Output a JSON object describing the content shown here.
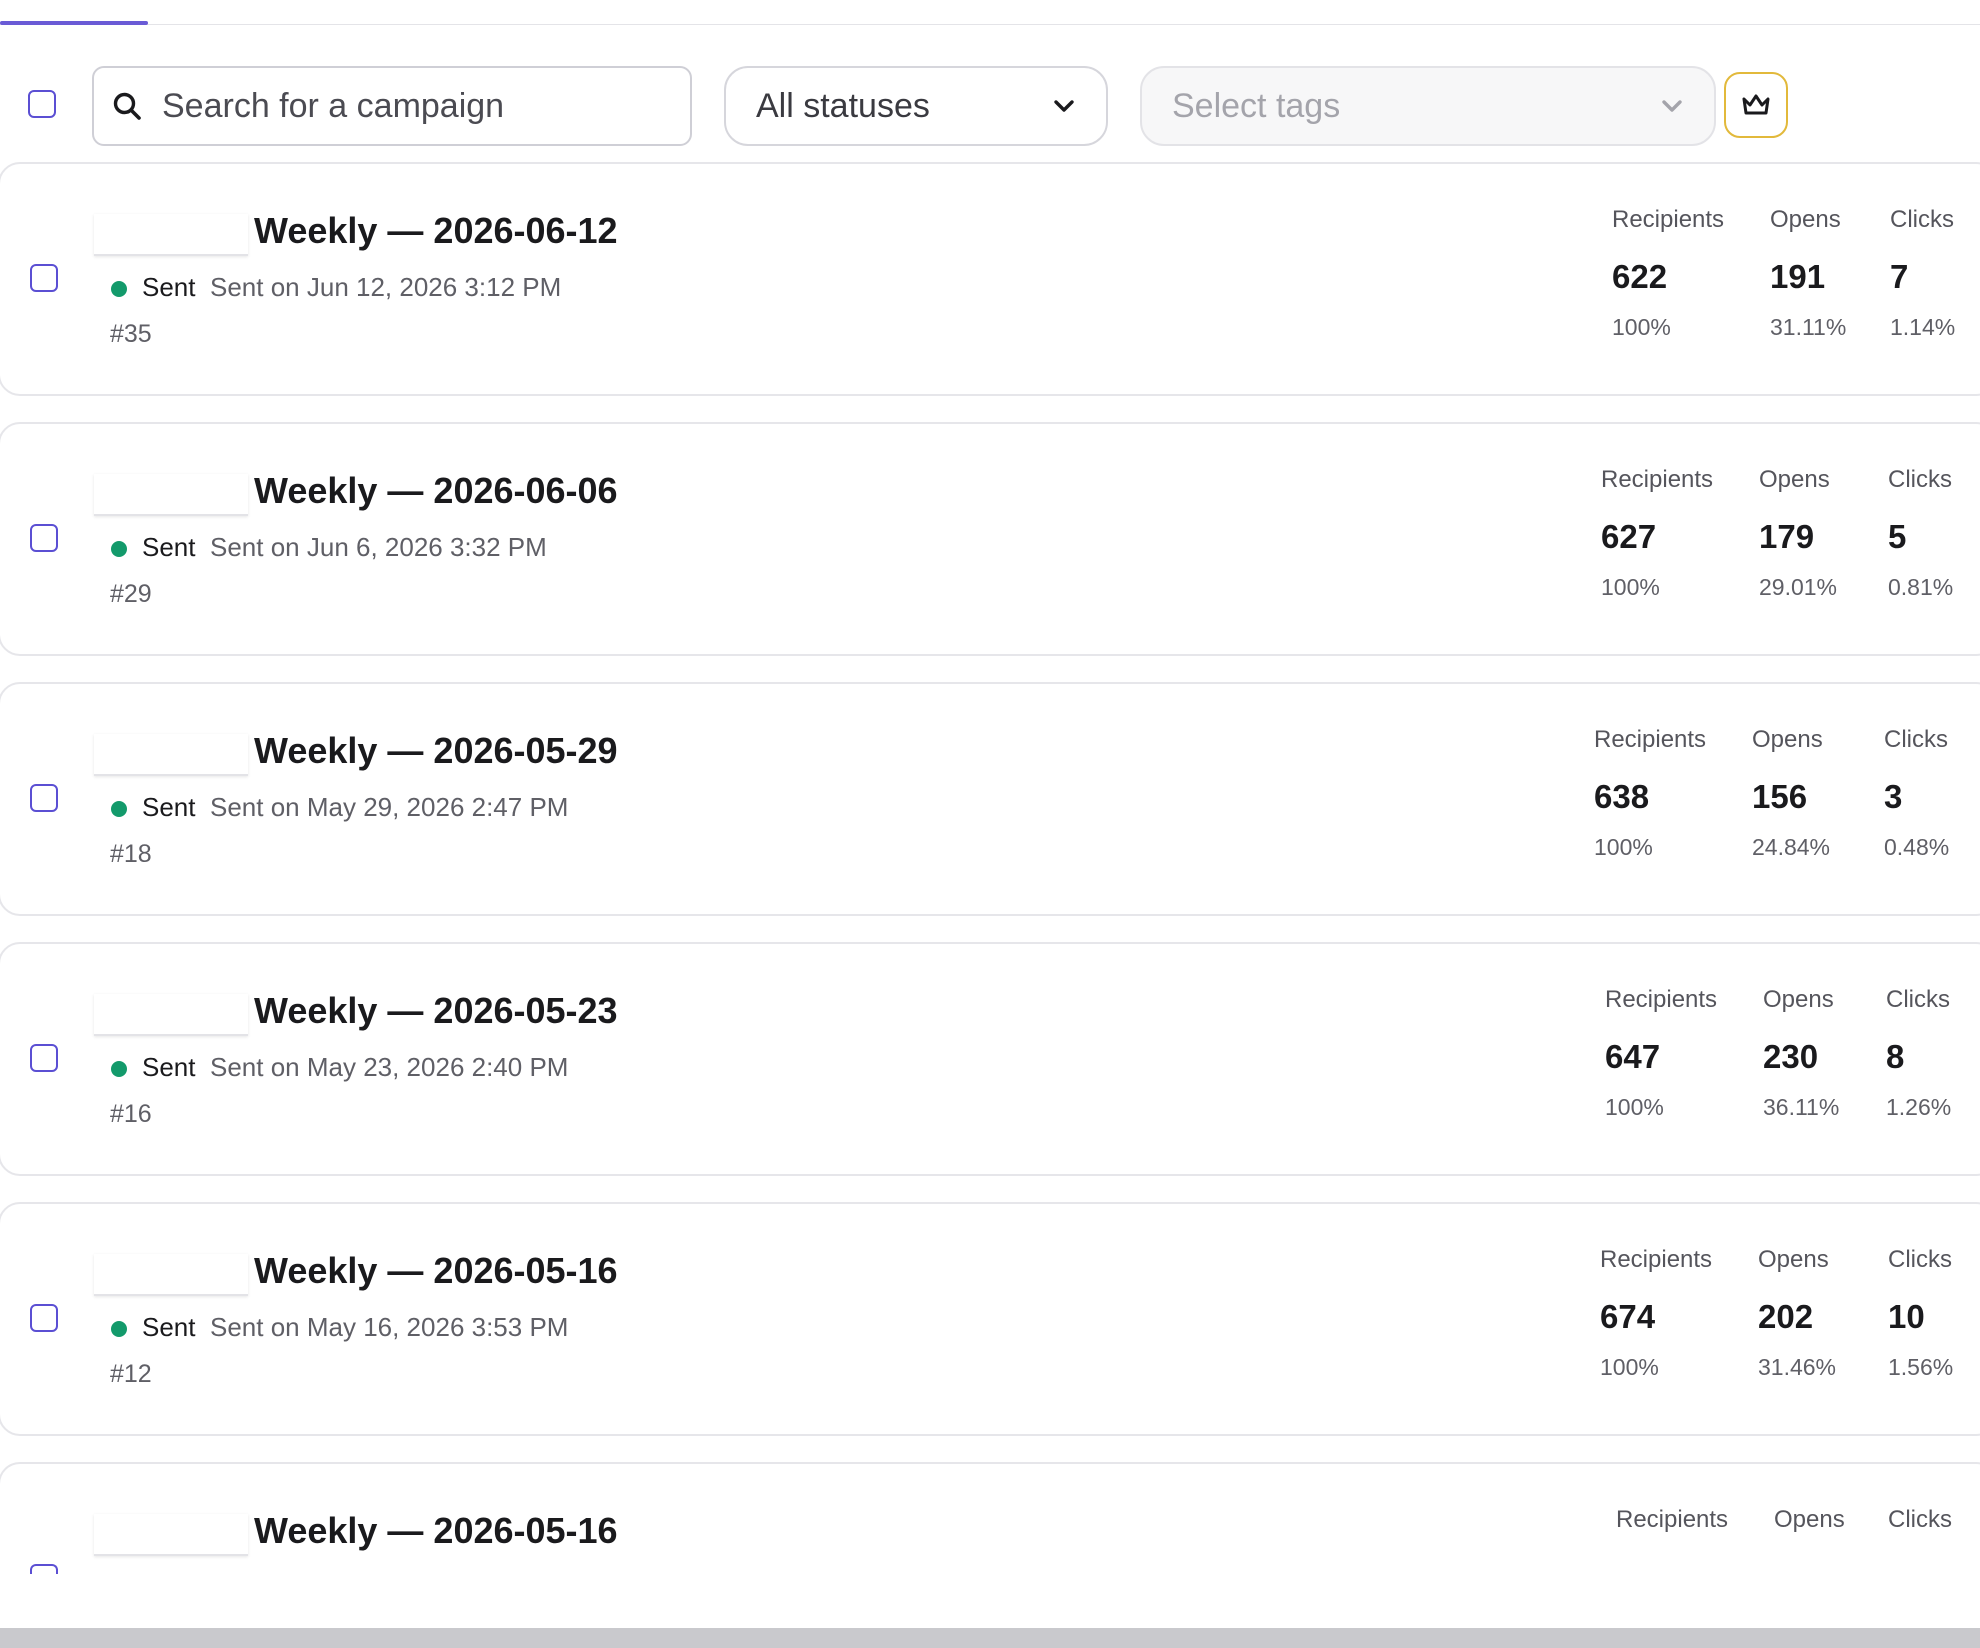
{
  "toolbar": {
    "search_placeholder": "Search for a campaign",
    "status_filter": "All statuses",
    "tags_placeholder": "Select tags"
  },
  "stat_labels": {
    "recipients": "Recipients",
    "opens": "Opens",
    "clicks": "Clicks"
  },
  "campaigns": [
    {
      "title": "Weekly — 2026-06-12",
      "status": "Sent",
      "sent_on": "Sent on Jun 12, 2026 3:12 PM",
      "id": "#35",
      "recipients": "622",
      "recipients_pct": "100%",
      "opens": "191",
      "opens_pct": "31.11%",
      "clicks": "7",
      "clicks_pct": "1.14%"
    },
    {
      "title": "Weekly — 2026-06-06",
      "status": "Sent",
      "sent_on": "Sent on Jun 6, 2026 3:32 PM",
      "id": "#29",
      "recipients": "627",
      "recipients_pct": "100%",
      "opens": "179",
      "opens_pct": "29.01%",
      "clicks": "5",
      "clicks_pct": "0.81%"
    },
    {
      "title": "Weekly — 2026-05-29",
      "status": "Sent",
      "sent_on": "Sent on May 29, 2026 2:47 PM",
      "id": "#18",
      "recipients": "638",
      "recipients_pct": "100%",
      "opens": "156",
      "opens_pct": "24.84%",
      "clicks": "3",
      "clicks_pct": "0.48%"
    },
    {
      "title": "Weekly — 2026-05-23",
      "status": "Sent",
      "sent_on": "Sent on May 23, 2026 2:40 PM",
      "id": "#16",
      "recipients": "647",
      "recipients_pct": "100%",
      "opens": "230",
      "opens_pct": "36.11%",
      "clicks": "8",
      "clicks_pct": "1.26%"
    },
    {
      "title": "Weekly — 2026-05-16",
      "status": "Sent",
      "sent_on": "Sent on May 16, 2026 3:53 PM",
      "id": "#12",
      "recipients": "674",
      "recipients_pct": "100%",
      "opens": "202",
      "opens_pct": "31.46%",
      "clicks": "10",
      "clicks_pct": "1.56%"
    },
    {
      "title": "Weekly — 2026-05-16"
    }
  ],
  "colors": {
    "accent": "#5b4fd3",
    "sent_status": "#139a6b",
    "premium": "#e2b93b"
  },
  "icons": {
    "search": "search-icon",
    "dropdown": "chevron-down-icon",
    "premium": "crown-icon"
  }
}
